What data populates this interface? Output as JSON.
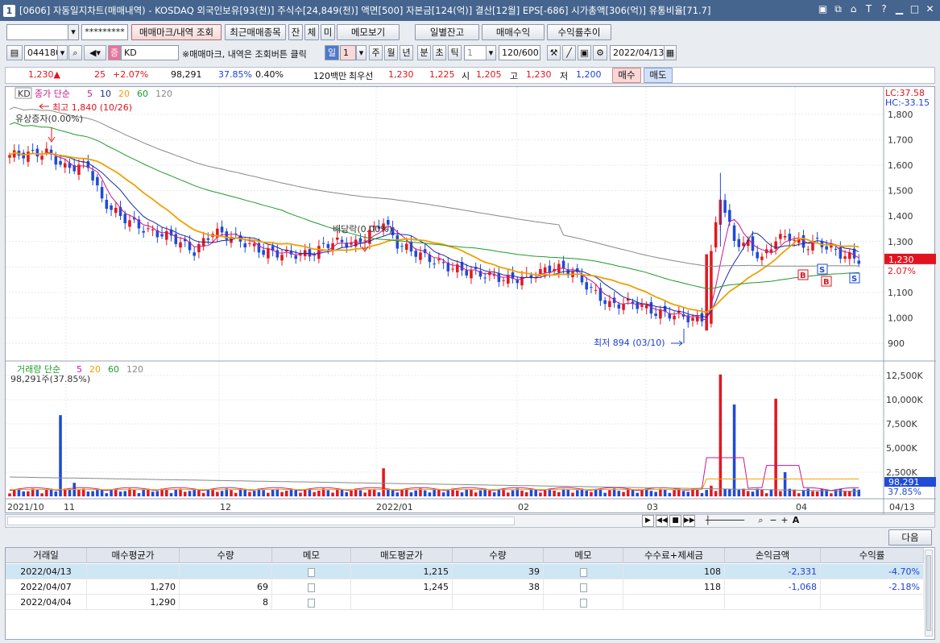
{
  "window": {
    "badge": "1",
    "title": "[0606] 자동일지차트(매매내역) - KOSDAQ 외국인보유[93(천)] 주식수[24,849(천)] 액면[500] 자본금[124(억)] 결산[12월] EPS[-686] 시가총액[306(억)] 유통비율[71.7]"
  },
  "toolbar": {
    "account_input": "",
    "password": "*********",
    "btn_trade_mark": "매매마크/내역 조회",
    "btn_recent": "최근매매종목",
    "btn_jan": "잔",
    "btn_che": "체",
    "btn_mi": "미",
    "btn_memo": "메모보기",
    "btn_daily": "일별잔고",
    "btn_profit": "매매수익",
    "btn_return": "수익률추이"
  },
  "toolbar2": {
    "code": "044180",
    "name": "KD",
    "note": "※매매마크, 내역은 조회버튼 클릭",
    "period_day": "일",
    "period_num": "1",
    "p_week": "주",
    "p_month": "월",
    "p_year": "년",
    "p_min": "분",
    "p_sec": "초",
    "p_tick": "틱",
    "tick_num": "1",
    "count": "120/600",
    "date": "2022/04/13"
  },
  "quote": {
    "price": "1,230▲",
    "change": "25",
    "change_pct": "+2.07%",
    "volume": "98,291",
    "vol_pct": "37.85%",
    "turnover": "0.40%",
    "unit": "120백만",
    "best_label": "최우선",
    "best_ask": "1,230",
    "best_bid": "1,225",
    "open_label": "시",
    "open": "1,205",
    "high_label": "고",
    "high": "1,230",
    "low_label": "저",
    "low": "1,200",
    "buy": "매수",
    "sell": "매도"
  },
  "chart": {
    "legend_kd": "KD",
    "legend_main": "종가 단순",
    "ma": [
      "5",
      "10",
      "20",
      "60",
      "120"
    ],
    "lc": "LC:37.58",
    "hc": "HC:-33.15",
    "max_label": "최고 1,840 (10/26)",
    "split_label": "유상증자(0.00%)",
    "div_label": "배당락(0.00%)",
    "min_label": "최저 894 (03/10)",
    "price_axis": [
      "1,800",
      "1,700",
      "1,600",
      "1,500",
      "1,400",
      "1,300",
      "1,230",
      "1,100",
      "1,000",
      "900"
    ],
    "price_tag": "1,230",
    "price_pct": "2.07%",
    "vol_legend": "거래량 단순",
    "vol_ma": [
      "5",
      "20",
      "60",
      "120"
    ],
    "vol_value": "98,291주(37.85%)",
    "vol_axis": [
      "12,500K",
      "10,000K",
      "7,500K",
      "5,000K",
      "2,500K"
    ],
    "vol_tag": "98,291",
    "vol_pct_tag": "37.85%",
    "dates": [
      "2021/10",
      "11",
      "12",
      "2022/01",
      "02",
      "03",
      "04",
      "04/13"
    ],
    "colors": {
      "up": "#e2181f",
      "down": "#1f4bd6",
      "ma5": "#c8188a",
      "ma10": "#1a2ba0",
      "ma20": "#f0a000",
      "ma60": "#1f9a2a",
      "ma120": "#888888"
    }
  },
  "bottom": {
    "next": "다음"
  },
  "table": {
    "headers": [
      "거래일",
      "매수평균가",
      "수량",
      "메모",
      "매도평균가",
      "수량",
      "메모",
      "수수료+제세금",
      "손익금액",
      "수익률"
    ],
    "rows": [
      [
        "2022/04/13",
        "",
        "",
        "",
        "1,215",
        "39",
        "",
        "108",
        "-2,331",
        "-4.70%"
      ],
      [
        "2022/04/07",
        "1,270",
        "69",
        "",
        "1,245",
        "38",
        "",
        "118",
        "-1,068",
        "-2.18%"
      ],
      [
        "2022/04/04",
        "1,290",
        "8",
        "",
        "",
        "",
        "",
        "",
        "",
        ""
      ]
    ]
  }
}
